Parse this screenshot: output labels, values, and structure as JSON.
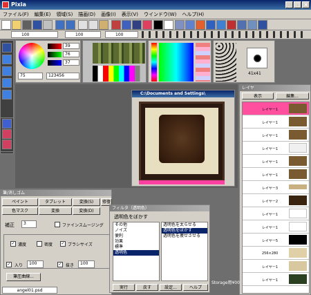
{
  "window": {
    "title": "Pixia"
  },
  "menu": {
    "items": [
      "ファイル(F)",
      "編集(E)",
      "領域(S)",
      "描画(D)",
      "画像(I)",
      "表示(V)",
      "ウインドウ(W)",
      "ヘルプ(H)"
    ]
  },
  "toolbar2": {
    "size_a": "100",
    "size_b": "100",
    "size_c": "100"
  },
  "color_panel": {
    "r": "39",
    "g": "76",
    "b": "37",
    "alpha": "75",
    "hex": "123456"
  },
  "nav": {
    "size_label": "41x41"
  },
  "canvas_window": {
    "title": "C:\\Documents and Settings\\"
  },
  "layers": {
    "title": "レイヤ",
    "buttons": [
      "表示",
      "編集..."
    ],
    "items": [
      "レイヤー1",
      "レイヤー1",
      "レイヤー1",
      "レイヤー1",
      "レイヤー1",
      "レイヤー1",
      "レイヤー3",
      "レイヤー2",
      "レイヤー1",
      "レイヤー1",
      "レイヤー5",
      "256×280",
      "レイヤー1",
      "レイヤー1"
    ]
  },
  "brush_panel": {
    "title": "筆/消しゴム",
    "tab_row1": [
      "ペイント",
      "タブレット",
      "変換(S)",
      "修復(H)"
    ],
    "tab_row2": [
      "色マスク",
      "変換",
      "変換(D)"
    ],
    "correction_label": "補正",
    "correction_value": "3",
    "smoothing_label": "ファインスムージング",
    "opt1": "濃度",
    "opt2": "密度",
    "opt3": "ブラシサイズ",
    "in_label": "入り",
    "in_value": "100",
    "out_label": "抜き",
    "out_value": "100",
    "curve_button": "筆圧曲線...",
    "status": "angel01.psd"
  },
  "filter_panel": {
    "title": "フィルタ（透明色）",
    "header": "透明色をぼかす",
    "categories": [
      "その他",
      "ノイズ",
      "便利",
      "効果",
      "標準",
      "透明色"
    ],
    "effects": [
      "透明色を太らせる",
      "透明色をぼかす",
      "透明色を痩せさせる"
    ],
    "buttons": [
      "実行",
      "戻す",
      "設定...",
      "ヘルプ"
    ]
  },
  "status_right": "Storage用¥00"
}
